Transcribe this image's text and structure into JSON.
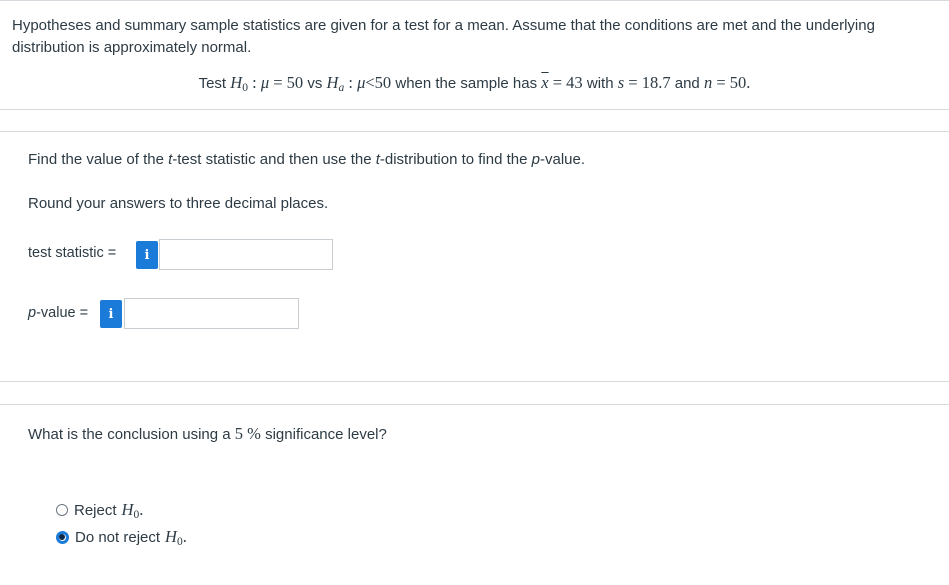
{
  "problem": {
    "intro": "Hypotheses and summary sample statistics are given for a test for a mean. Assume that the conditions are met and the underlying distribution is approximately normal.",
    "hyp_prefix": "Test",
    "h0_eq": "= 50",
    "vs": "vs",
    "ha_eq": "<50",
    "sample_text": "when the sample has",
    "xbar_eq": "= 43",
    "with": "with",
    "s_eq": "= 18.7",
    "and": "and",
    "n_eq": "= 50."
  },
  "part1": {
    "instruction_a": "Find the value of the ",
    "instruction_t1": "t",
    "instruction_b": "-test statistic and then use the ",
    "instruction_t2": "t",
    "instruction_c": "-distribution to find the ",
    "instruction_p": "p",
    "instruction_d": "-value.",
    "rounding": "Round your answers to three decimal places.",
    "test_statistic_label": "test statistic =",
    "test_statistic_value": "",
    "p_value_label_p": "p",
    "p_value_label_rest": "-value =",
    "p_value_value": "",
    "info_glyph": "i"
  },
  "part2": {
    "question_a": "What is the conclusion using a",
    "question_num": "5 %",
    "question_b": "significance level?",
    "options": [
      {
        "label": "Reject",
        "checked": false
      },
      {
        "label": "Do not reject",
        "checked": true
      }
    ],
    "h0_symbol": "H",
    "h0_sub": "0",
    "period": "."
  },
  "colors": {
    "accent": "#1a7bd9",
    "text": "#2d3b45",
    "divider": "#d7dbdf"
  }
}
